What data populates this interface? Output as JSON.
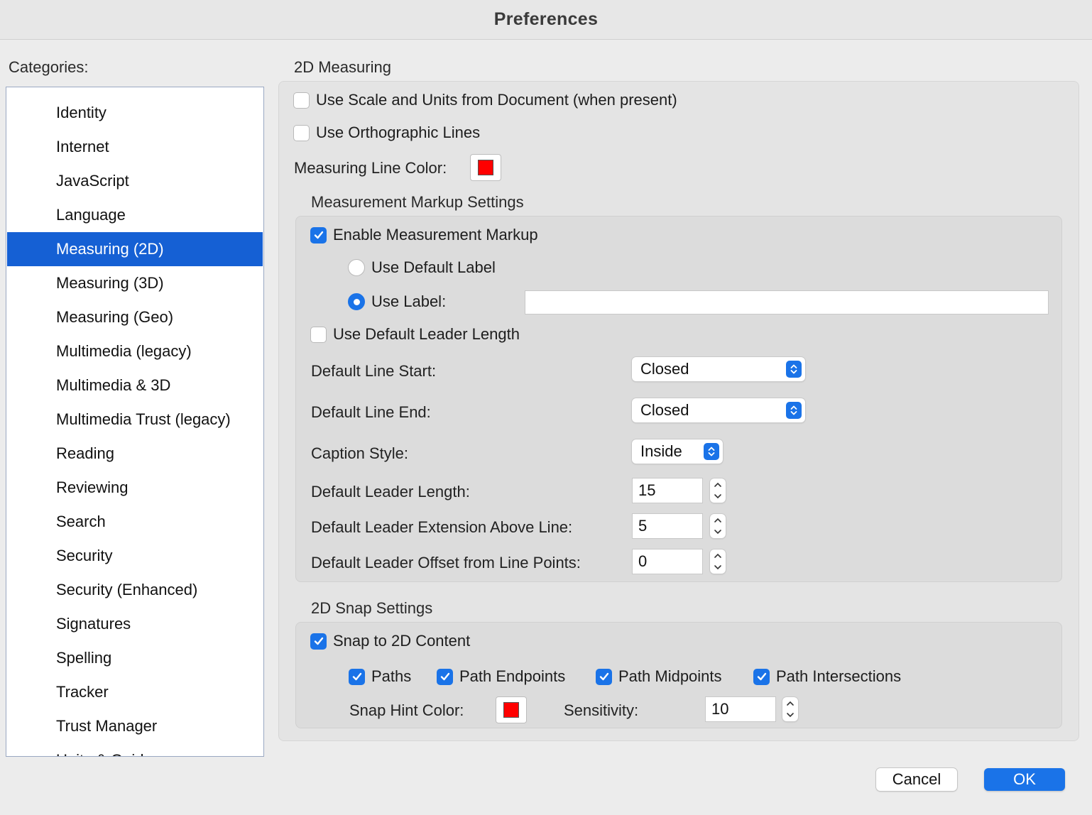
{
  "window": {
    "title": "Preferences"
  },
  "sidebar": {
    "label": "Categories:",
    "items": [
      {
        "label": "Identity"
      },
      {
        "label": "Internet"
      },
      {
        "label": "JavaScript"
      },
      {
        "label": "Language"
      },
      {
        "label": "Measuring (2D)",
        "selected": true
      },
      {
        "label": "Measuring (3D)"
      },
      {
        "label": "Measuring (Geo)"
      },
      {
        "label": "Multimedia (legacy)"
      },
      {
        "label": "Multimedia & 3D"
      },
      {
        "label": "Multimedia Trust (legacy)"
      },
      {
        "label": "Reading"
      },
      {
        "label": "Reviewing"
      },
      {
        "label": "Search"
      },
      {
        "label": "Security"
      },
      {
        "label": "Security (Enhanced)"
      },
      {
        "label": "Signatures"
      },
      {
        "label": "Spelling"
      },
      {
        "label": "Tracker"
      },
      {
        "label": "Trust Manager"
      },
      {
        "label": "Units & Guides"
      }
    ]
  },
  "main": {
    "section_title": "2D Measuring",
    "use_scale_units": {
      "label": "Use Scale and Units from Document (when present)",
      "checked": false
    },
    "use_ortho_lines": {
      "label": "Use Orthographic Lines",
      "checked": false
    },
    "line_color": {
      "label": "Measuring Line Color:",
      "color": "#ff0000"
    },
    "markup": {
      "title": "Measurement Markup Settings",
      "enable": {
        "label": "Enable Measurement Markup",
        "checked": true
      },
      "default_label": {
        "label": "Use Default Label",
        "selected": false
      },
      "use_label": {
        "label": "Use Label:",
        "selected": true,
        "value": ""
      },
      "default_leader": {
        "label": "Use Default Leader Length",
        "checked": false
      },
      "line_start": {
        "label": "Default Line Start:",
        "value": "Closed"
      },
      "line_end": {
        "label": "Default Line End:",
        "value": "Closed"
      },
      "caption_style": {
        "label": "Caption Style:",
        "value": "Inside"
      },
      "leader_length": {
        "label": "Default Leader Length:",
        "value": "15"
      },
      "leader_extension": {
        "label": "Default Leader Extension Above Line:",
        "value": "5"
      },
      "leader_offset": {
        "label": "Default Leader Offset from Line Points:",
        "value": "0"
      }
    },
    "snap": {
      "title": "2D Snap Settings",
      "snap_content": {
        "label": "Snap to 2D Content",
        "checked": true
      },
      "paths": {
        "label": "Paths",
        "checked": true
      },
      "path_endpoints": {
        "label": "Path Endpoints",
        "checked": true
      },
      "path_midpoints": {
        "label": "Path Midpoints",
        "checked": true
      },
      "path_intersections": {
        "label": "Path Intersections",
        "checked": true
      },
      "hint_color": {
        "label": "Snap Hint Color:",
        "color": "#ff0000"
      },
      "sensitivity": {
        "label": "Sensitivity:",
        "value": "10"
      }
    }
  },
  "footer": {
    "cancel_label": "Cancel",
    "ok_label": "OK"
  },
  "colors": {
    "accent": "#1a73e8",
    "selection": "#1560d4"
  }
}
